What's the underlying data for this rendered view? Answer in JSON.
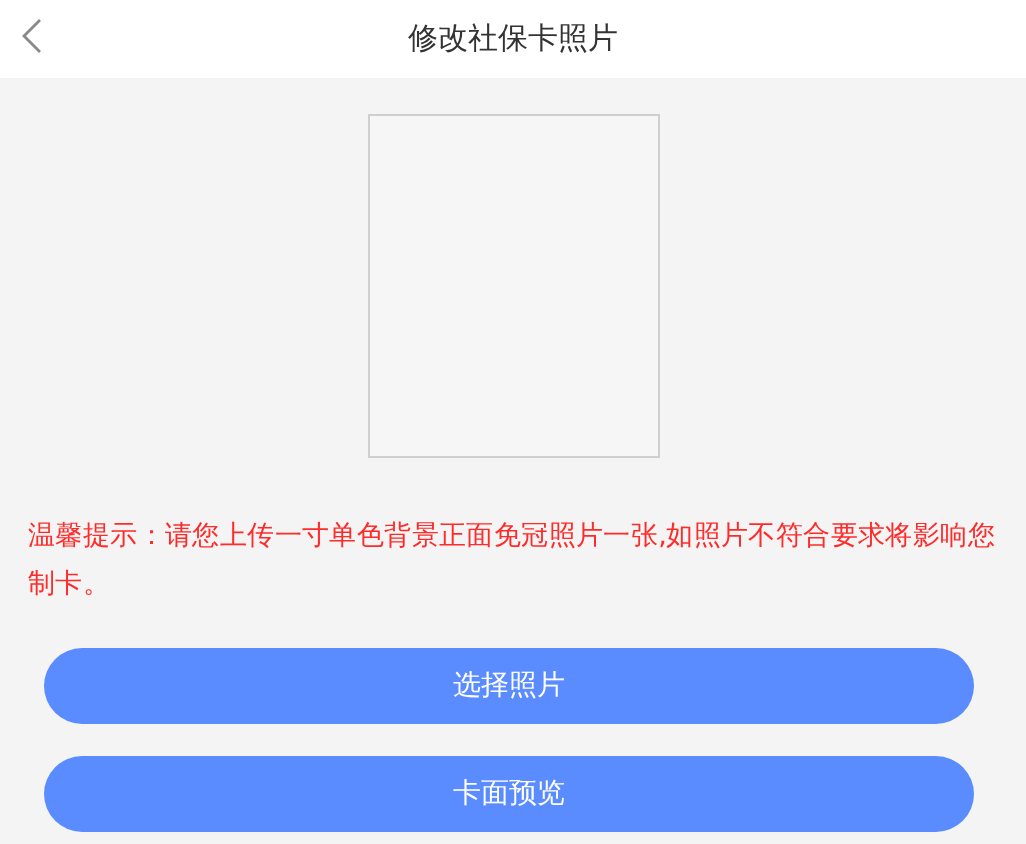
{
  "header": {
    "title": "修改社保卡照片"
  },
  "photo": {
    "kind": "picture-slot"
  },
  "tip": "温馨提示：请您上传一寸单色背景正面免冠照片一张,如照片不符合要求将影响您制卡。",
  "buttons": [
    {
      "label": "选择照片"
    },
    {
      "label": "卡面预览"
    }
  ]
}
